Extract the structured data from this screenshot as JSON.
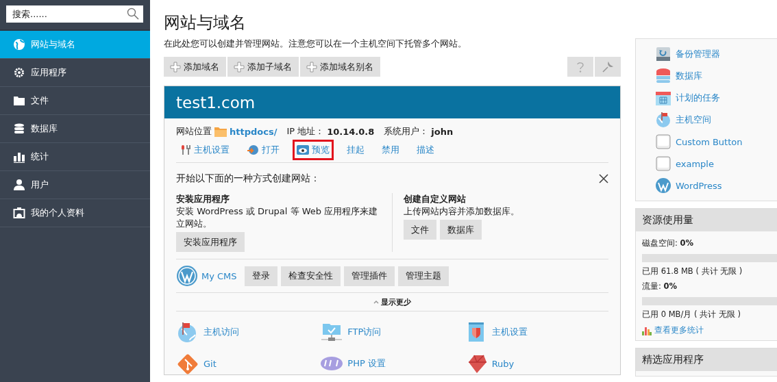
{
  "search": {
    "placeholder": "搜索......"
  },
  "nav": [
    {
      "label": "网站与域名",
      "selected": true
    },
    {
      "label": "应用程序",
      "selected": false
    },
    {
      "label": "文件",
      "selected": false
    },
    {
      "label": "数据库",
      "selected": false
    },
    {
      "label": "统计",
      "selected": false
    },
    {
      "label": "用户",
      "selected": false
    },
    {
      "label": "我的个人资料",
      "selected": false
    }
  ],
  "page": {
    "title": "网站与域名",
    "description": "在此处您可以创建并管理网站。注意您可以在一个主机空间下托管多个网站。"
  },
  "toolbar": [
    "添加域名",
    "添加子域名",
    "添加域名别名"
  ],
  "domain": {
    "title": "test1.com",
    "location_label": "网站位置",
    "location": "httpdocs/",
    "ip_label": "IP 地址：",
    "ip": "10.14.0.8",
    "user_label": "系统用户：",
    "user": "john",
    "actions": [
      {
        "label": "主机设置",
        "highlighted": false
      },
      {
        "label": "打开",
        "highlighted": false
      },
      {
        "label": "预览",
        "highlighted": true
      },
      {
        "label": "挂起",
        "highlighted": false
      },
      {
        "label": "禁用",
        "highlighted": false
      },
      {
        "label": "描述",
        "highlighted": false
      }
    ],
    "create": {
      "title": "开始以下面的一种方式创建网站：",
      "options": [
        {
          "heading": "安装应用程序",
          "text": "安装 WordPress 或 Drupal 等 Web 应用程序来建立网站。",
          "buttons": [
            "安装应用程序"
          ]
        },
        {
          "heading": "创建自定义网站",
          "text": "上传网站内容并添加数据库。",
          "buttons": [
            "文件",
            "数据库"
          ]
        }
      ]
    },
    "cms": {
      "name": "My CMS",
      "buttons": [
        "登录",
        "检查安全性",
        "管理插件",
        "管理主题"
      ]
    },
    "toggle": "显示更少",
    "tools": [
      "主机访问",
      "FTP访问",
      "主机设置",
      "Git",
      "PHP 设置",
      "Ruby"
    ]
  },
  "links": [
    "备份管理器",
    "数据库",
    "计划的任务",
    "主机空间",
    "Custom Button",
    "example",
    "WordPress"
  ],
  "resources": {
    "title": "资源使用量",
    "meters": [
      {
        "label": "磁盘空间: **0%**",
        "level": 0,
        "used": "已用 61.8 MB ( 共计 无限 )"
      },
      {
        "label": "流量: **0%**",
        "level": 0,
        "used": "已用 0 MB/月 ( 共计 无限 )"
      }
    ],
    "more": "查看更多统计"
  },
  "featured": {
    "title": "精选应用程序"
  }
}
